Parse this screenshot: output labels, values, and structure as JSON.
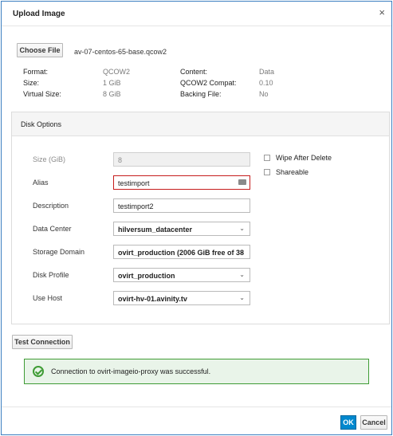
{
  "dialog": {
    "title": "Upload Image",
    "close_glyph": "×"
  },
  "file": {
    "choose_button": "Choose File",
    "name": "av-07-centos-65-base.qcow2"
  },
  "meta": {
    "format_label": "Format:",
    "format_value": "QCOW2",
    "size_label": "Size:",
    "size_value": "1 GiB",
    "vsize_label": "Virtual Size:",
    "vsize_value": "8 GiB",
    "content_label": "Content:",
    "content_value": "Data",
    "compat_label": "QCOW2 Compat:",
    "compat_value": "0.10",
    "backing_label": "Backing File:",
    "backing_value": "No"
  },
  "disk_options": {
    "title": "Disk Options",
    "size_label": "Size (GiB)",
    "size_value": "8",
    "alias_label": "Alias",
    "alias_value": "testimport",
    "description_label": "Description",
    "description_value": "testimport2",
    "data_center_label": "Data Center",
    "data_center_value": "hilversum_datacenter",
    "storage_domain_label": "Storage Domain",
    "storage_domain_value": "ovirt_production (2006 GiB free of 38",
    "disk_profile_label": "Disk Profile",
    "disk_profile_value": "ovirt_production",
    "use_host_label": "Use Host",
    "use_host_value": "ovirt-hv-01.avinity.tv",
    "wipe_label": "Wipe After Delete",
    "shareable_label": "Shareable",
    "chevron_glyph": "⌄"
  },
  "test": {
    "button_label": "Test Connection",
    "alert_text": "Connection to ovirt-imageio-proxy was successful."
  },
  "footer": {
    "ok_label": "OK",
    "cancel_label": "Cancel"
  },
  "colors": {
    "primary": "#0088ce",
    "success": "#3f9c35",
    "error": "#c61c1c"
  }
}
